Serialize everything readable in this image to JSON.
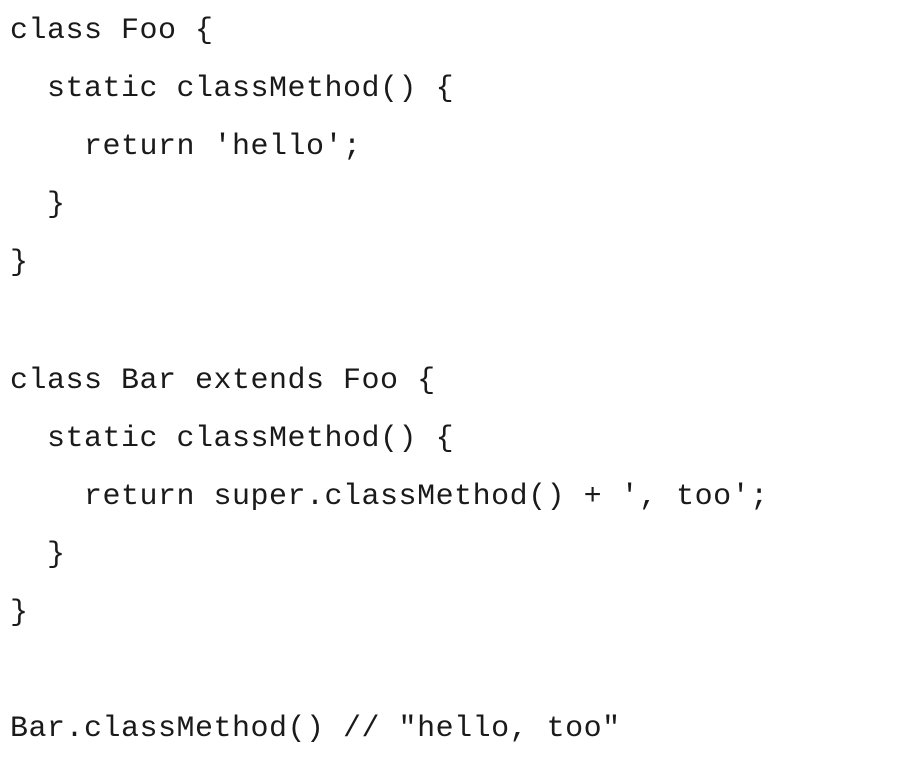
{
  "code": {
    "lines": [
      "class Foo {",
      "  static classMethod() {",
      "    return 'hello';",
      "  }",
      "}",
      "",
      "class Bar extends Foo {",
      "  static classMethod() {",
      "    return super.classMethod() + ', too';",
      "  }",
      "}",
      "",
      "Bar.classMethod() // \"hello, too\""
    ]
  }
}
